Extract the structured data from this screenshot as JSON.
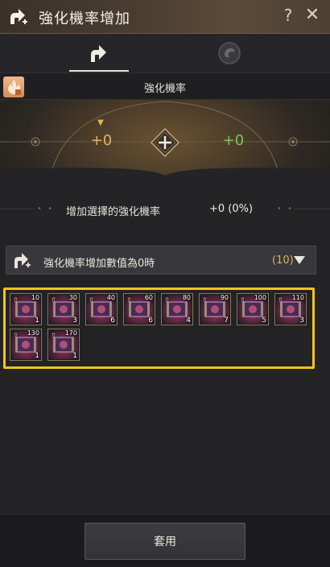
{
  "window": {
    "title": "強化機率增加",
    "help_label": "?",
    "close_label": "✕"
  },
  "tabs": [
    {
      "icon": "enhance-arrow-icon",
      "active": true
    },
    {
      "icon": "dragon-emblem-icon",
      "active": false
    }
  ],
  "header": {
    "label": "強化機率",
    "badge_icon": "warning-badge-icon"
  },
  "dial": {
    "current_value": "+0",
    "added_value": "+0",
    "marker": "▼",
    "plus_label": "+"
  },
  "info": {
    "label": "增加選擇的強化機率",
    "value": "+0 (0%)",
    "dots": "• •"
  },
  "dropdown": {
    "label": "強化機率增加數值為0時",
    "count": "(10)",
    "icon": "enhance-arrow-icon",
    "arrow_icon": "chevron-down-icon"
  },
  "items": [
    {
      "cost": "10",
      "qty": "1"
    },
    {
      "cost": "30",
      "qty": "3"
    },
    {
      "cost": "40",
      "qty": "6"
    },
    {
      "cost": "60",
      "qty": "6"
    },
    {
      "cost": "80",
      "qty": "4"
    },
    {
      "cost": "90",
      "qty": "7"
    },
    {
      "cost": "100",
      "qty": "5"
    },
    {
      "cost": "110",
      "qty": "3"
    },
    {
      "cost": "130",
      "qty": "1"
    },
    {
      "cost": "170",
      "qty": "1"
    }
  ],
  "footer": {
    "apply_label": "套用"
  },
  "colors": {
    "accent_gold": "#e4b25a",
    "accent_green": "#74c85a",
    "highlight_frame": "#f3c41a"
  }
}
